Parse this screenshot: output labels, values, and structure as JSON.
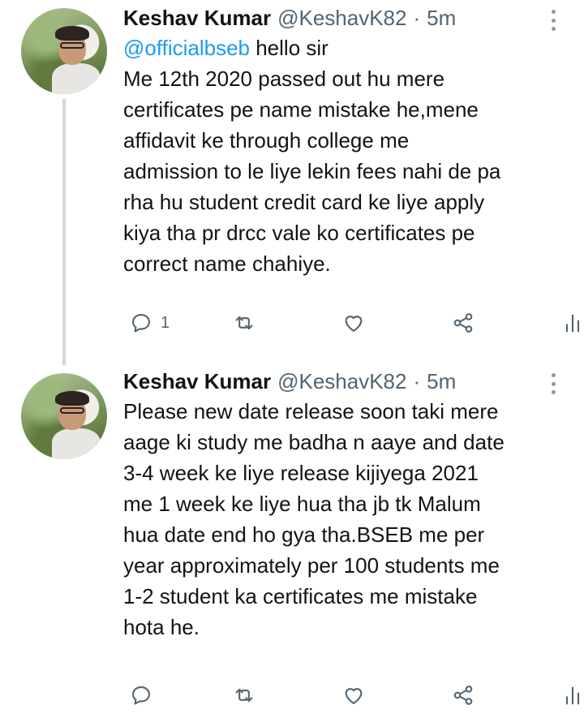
{
  "colors": {
    "accent": "#1d9bf0",
    "text": "#0f1419",
    "muted": "#536471",
    "thread_line": "#cfd9de"
  },
  "tweets": [
    {
      "author": {
        "name": "Keshav Kumar",
        "handle": "@KeshavK82",
        "separator": "·",
        "time": "5m"
      },
      "mention": "@officialbseb",
      "body_after_mention": " hello sir",
      "lines": [
        "Me 12th 2020 passed out hu mere",
        "certificates pe name mistake he,mene",
        "affidavit ke through college me",
        "admission to le liye lekin fees nahi de pa",
        "rha hu student credit card ke liye apply",
        "kiya tha pr drcc vale ko certificates pe",
        "correct name chahiye."
      ],
      "actions": {
        "reply_icon": "reply-icon",
        "reply_count": "1",
        "retweet_icon": "retweet-icon",
        "like_icon": "heart-icon",
        "share_icon": "share-icon",
        "stats_icon": "stats-icon"
      }
    },
    {
      "author": {
        "name": "Keshav Kumar",
        "handle": "@KeshavK82",
        "separator": "·",
        "time": "5m"
      },
      "lines": [
        "Please new date release soon taki mere",
        "aage ki study me badha n aaye and date",
        "3-4 week ke liye release kijiyega 2021",
        "me 1 week ke liye hua tha jb tk Malum",
        "hua date end ho gya tha.BSEB me per",
        "year approximately per 100 students me",
        "1-2 student ka certificates me mistake",
        "hota he."
      ],
      "actions": {
        "reply_icon": "reply-icon",
        "retweet_icon": "retweet-icon",
        "like_icon": "heart-icon",
        "share_icon": "share-icon",
        "stats_icon": "stats-icon"
      }
    }
  ]
}
